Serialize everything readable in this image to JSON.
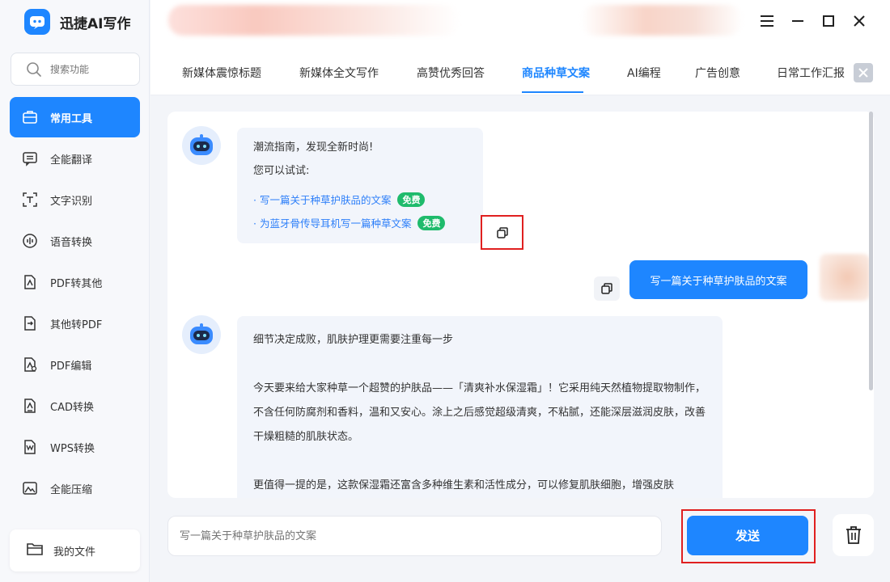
{
  "app": {
    "title": "迅捷AI写作"
  },
  "sidebar": {
    "search_placeholder": "搜索功能",
    "items": [
      {
        "label": "常用工具",
        "icon": "toolbox-icon",
        "active": true
      },
      {
        "label": "全能翻译",
        "icon": "translate-icon"
      },
      {
        "label": "文字识别",
        "icon": "text-recognition-icon"
      },
      {
        "label": "语音转换",
        "icon": "voice-icon"
      },
      {
        "label": "PDF转其他",
        "icon": "pdf-convert-icon"
      },
      {
        "label": "其他转PDF",
        "icon": "to-pdf-icon"
      },
      {
        "label": "PDF编辑",
        "icon": "pdf-edit-icon"
      },
      {
        "label": "CAD转换",
        "icon": "cad-icon"
      },
      {
        "label": "WPS转换",
        "icon": "wps-icon"
      },
      {
        "label": "全能压缩",
        "icon": "compress-icon"
      }
    ],
    "my_files": "我的文件"
  },
  "tabs": [
    {
      "label": "新媒体震惊标题"
    },
    {
      "label": "新媒体全文写作"
    },
    {
      "label": "高赞优秀回答"
    },
    {
      "label": "商品种草文案",
      "active": true
    },
    {
      "label": "AI编程"
    },
    {
      "label": "广告创意"
    },
    {
      "label": "日常工作汇报"
    }
  ],
  "chat": {
    "welcome": {
      "line1": "潮流指南，发现全新时尚!",
      "line2": "您可以试试:",
      "suggestions": [
        {
          "text": "· 写一篇关于种草护肤品的文案",
          "badge": "免费"
        },
        {
          "text": "· 为蓝牙骨传导耳机写一篇种草文案",
          "badge": "免费"
        }
      ]
    },
    "user_message": "写一篇关于种草护肤品的文案",
    "reply": {
      "p1": "细节决定成败，肌肤护理更需要注重每一步",
      "p2": "今天要来给大家种草一个超赞的护肤品——「清爽补水保湿霜」！它采用纯天然植物提取物制作，不含任何防腐剂和香料，温和又安心。涂上之后感觉超级清爽，不粘腻，还能深层滋润皮肤，改善干燥粗糙的肌肤状态。",
      "p3": "更值得一提的是，这款保湿霜还富含多种维生素和活性成分，可以修复肌肤细胞，增强皮肤"
    }
  },
  "composer": {
    "placeholder": "写一篇关于种草护肤品的文案",
    "send_label": "发送"
  },
  "colors": {
    "accent": "#1e86ff",
    "badge": "#1fbb6c",
    "highlight": "#e02020"
  }
}
